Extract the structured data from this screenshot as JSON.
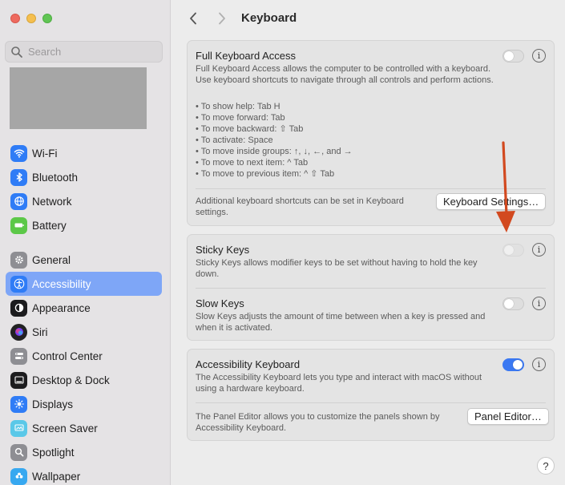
{
  "window": {
    "title": "Keyboard"
  },
  "search": {
    "placeholder": "Search"
  },
  "sidebar": {
    "items": [
      {
        "label": "Wi-Fi",
        "icon": "wifi-icon",
        "color": "#2f7cf6"
      },
      {
        "label": "Bluetooth",
        "icon": "bluetooth-icon",
        "color": "#2f7cf6"
      },
      {
        "label": "Network",
        "icon": "globe-icon",
        "color": "#2f7cf6"
      },
      {
        "label": "Battery",
        "icon": "battery-icon",
        "color": "#5cc848"
      },
      {
        "label": "General",
        "icon": "gear-icon",
        "color": "#8e8e93"
      },
      {
        "label": "Accessibility",
        "icon": "accessibility-icon",
        "color": "#2f7cf6",
        "selected": true
      },
      {
        "label": "Appearance",
        "icon": "appearance-icon",
        "color": "#1c1c1e"
      },
      {
        "label": "Siri",
        "icon": "siri-icon",
        "color": "#7a3df0"
      },
      {
        "label": "Control Center",
        "icon": "control-center-icon",
        "color": "#8e8e93"
      },
      {
        "label": "Desktop & Dock",
        "icon": "dock-icon",
        "color": "#1c1c1e"
      },
      {
        "label": "Displays",
        "icon": "sun-icon",
        "color": "#2f7cf6"
      },
      {
        "label": "Screen Saver",
        "icon": "screen-saver-icon",
        "color": "#5ac8e8"
      },
      {
        "label": "Spotlight",
        "icon": "magnifier-icon",
        "color": "#8e8e93"
      },
      {
        "label": "Wallpaper",
        "icon": "flower-icon",
        "color": "#37a8f0"
      }
    ]
  },
  "keyboard_access": {
    "title": "Full Keyboard Access",
    "description": "Full Keyboard Access allows the computer to be controlled with a keyboard. Use keyboard shortcuts to navigate through all controls and perform actions.",
    "enabled": false,
    "bullets": [
      "• To show help: Tab H",
      "• To move forward: Tab",
      "• To move backward: ⇧ Tab",
      "• To activate: Space",
      "• To move inside groups: ↑, ↓, ←, and →",
      "• To move to next item: ^ Tab",
      "• To move to previous item: ^ ⇧ Tab"
    ],
    "footer_text": "Additional keyboard shortcuts can be set in Keyboard settings.",
    "settings_button": "Keyboard Settings…"
  },
  "sticky_keys": {
    "title": "Sticky Keys",
    "description": "Sticky Keys allows modifier keys to be set without having to hold the key down.",
    "enabled": false
  },
  "slow_keys": {
    "title": "Slow Keys",
    "description": "Slow Keys adjusts the amount of time between when a key is pressed and when it is activated.",
    "enabled": false
  },
  "accessibility_keyboard": {
    "title": "Accessibility Keyboard",
    "description": "The Accessibility Keyboard lets you type and interact with macOS without using a hardware keyboard.",
    "enabled": true,
    "footer_text": "The Panel Editor allows you to customize the panels shown by Accessibility Keyboard.",
    "panel_button": "Panel Editor…"
  },
  "help": {
    "label": "?"
  },
  "colors": {
    "accent": "#3a78f2",
    "selection": "#7ea6f7",
    "annotation_arrow": "#d2491f"
  }
}
